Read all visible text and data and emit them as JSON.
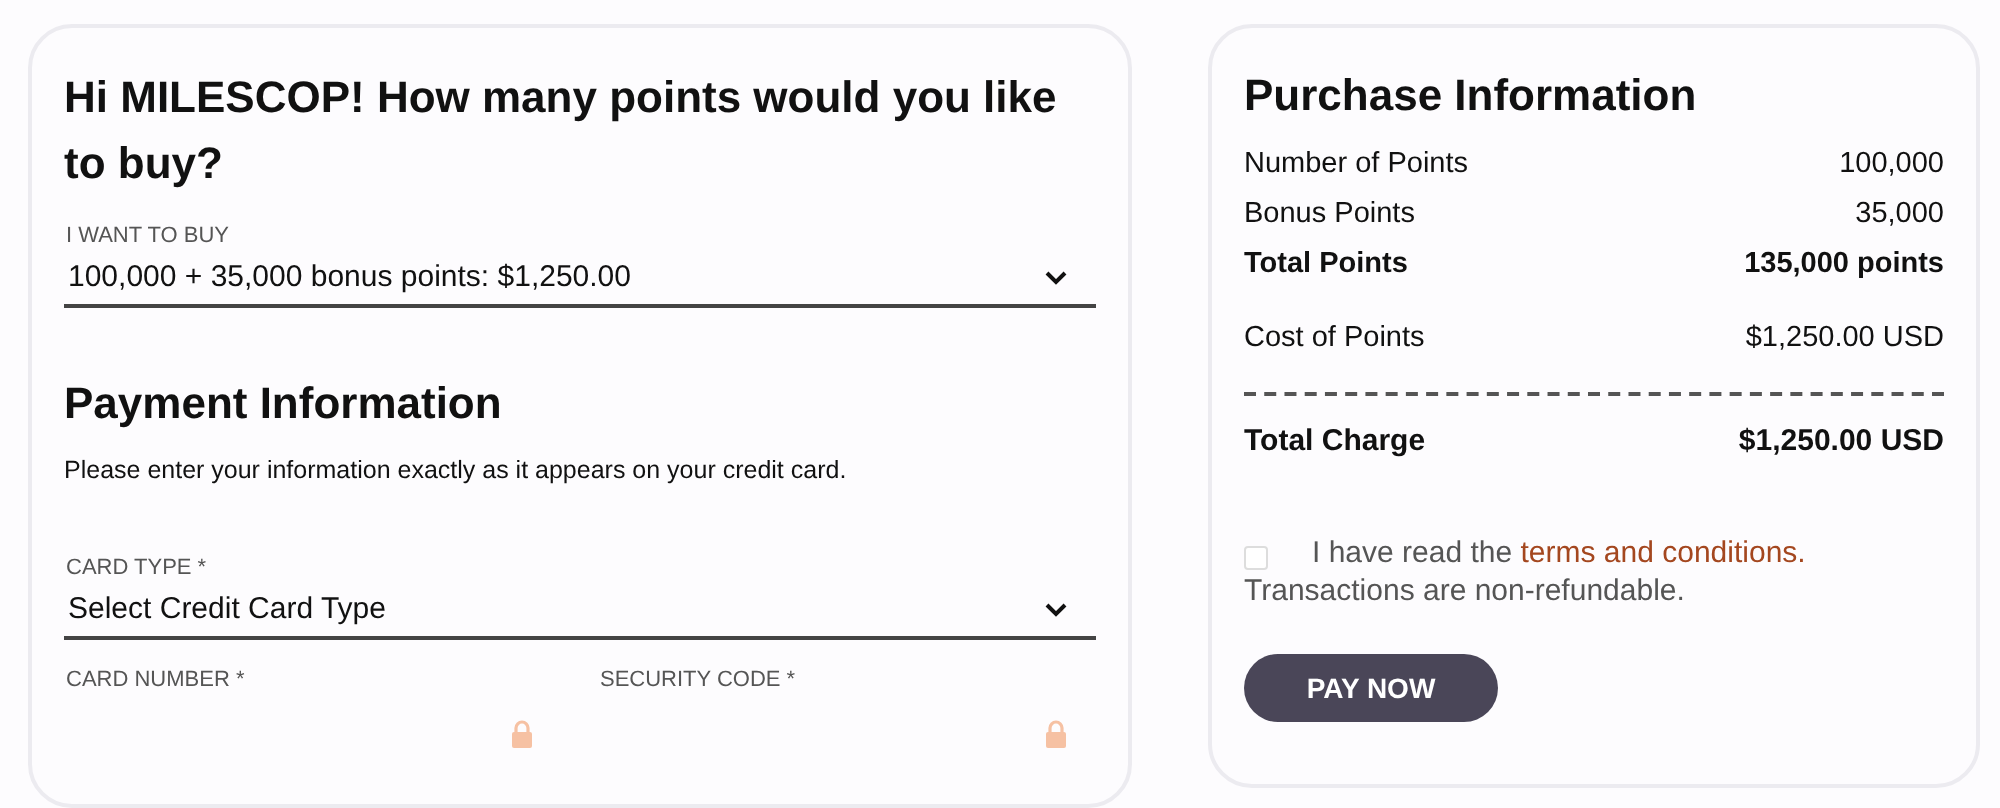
{
  "buy": {
    "heading": "Hi MILESCOP! How many points would you like to buy?",
    "label": "I WANT TO BUY",
    "value": "100,000 + 35,000 bonus points: $1,250.00"
  },
  "payment": {
    "heading": "Payment Information",
    "note": "Please enter your information exactly as it appears on your credit card.",
    "card_type": {
      "label": "CARD TYPE *",
      "value": "Select Credit Card Type"
    },
    "fields": [
      {
        "label": "CARD NUMBER *"
      },
      {
        "label": "SECURITY CODE *"
      }
    ]
  },
  "purchase": {
    "heading": "Purchase Information",
    "rows": [
      {
        "label": "Number of Points",
        "value": "100,000",
        "kind": "plain"
      },
      {
        "label": "Bonus Points",
        "value": "35,000",
        "kind": "plain"
      },
      {
        "label": "Total Points",
        "value": "135,000 points",
        "kind": "bold"
      },
      {
        "label": "Cost of Points",
        "value": "$1,250.00 USD",
        "kind": "spaced"
      }
    ],
    "total": {
      "label": "Total Charge",
      "value": "$1,250.00 USD"
    },
    "terms": {
      "checked": false,
      "before": "I have read the",
      "link": "terms and conditions.",
      "after": "Transactions are non-refundable."
    },
    "button": "PAY NOW"
  }
}
